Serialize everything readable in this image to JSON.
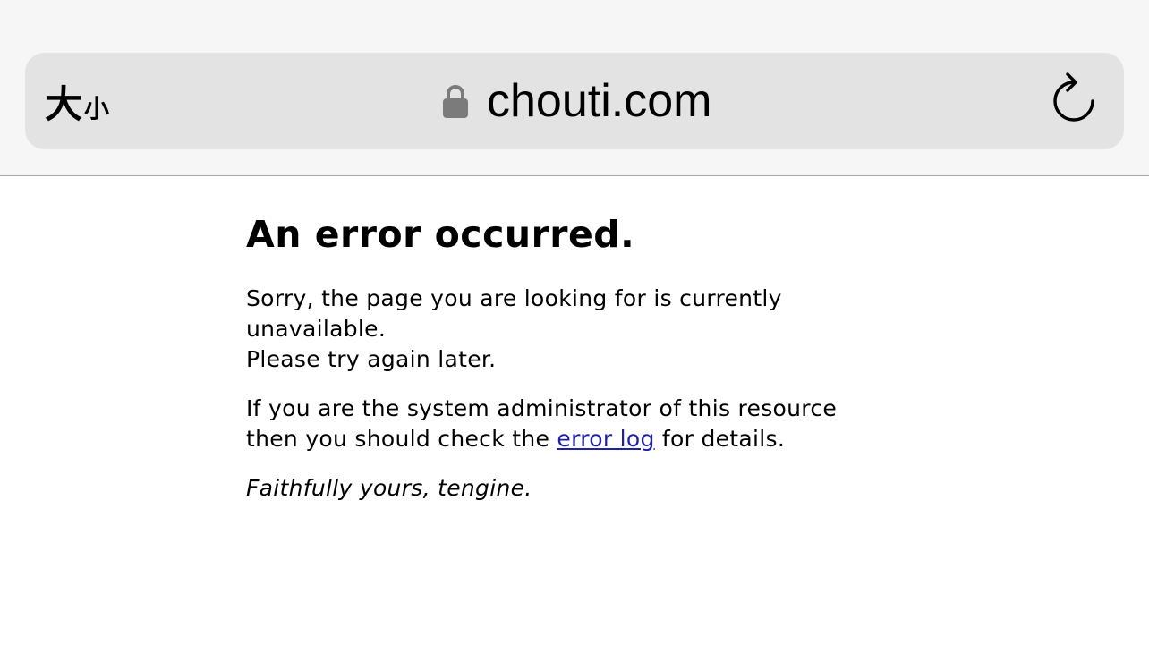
{
  "browser": {
    "text_size_big": "大",
    "text_size_small": "小",
    "url": "chouti.com",
    "lock_icon": "lock-icon",
    "reload_icon": "reload-icon"
  },
  "page": {
    "heading": "An error occurred.",
    "p1_line1": "Sorry, the page you are looking for is currently unavailable.",
    "p1_line2": "Please try again later.",
    "p2_before": "If you are the system administrator of this resource then you should check the ",
    "p2_link": "error log",
    "p2_after": " for details.",
    "signature": "Faithfully yours, tengine."
  },
  "colors": {
    "chrome_bg": "#f6f6f6",
    "address_bar_bg": "#e3e3e3",
    "link": "#1f1fa8",
    "lock": "#7b7b7b"
  }
}
